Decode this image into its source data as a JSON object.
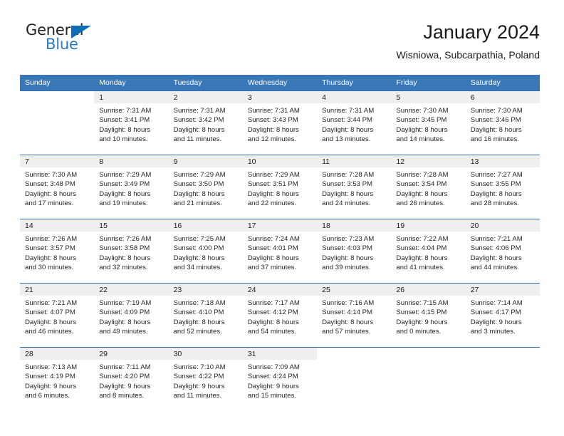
{
  "brand": {
    "name_part1": "General",
    "name_part2": "Blue",
    "logo_icon": "triangle-logo-icon"
  },
  "header": {
    "title": "January 2024",
    "subtitle": "Wisniowa, Subcarpathia, Poland"
  },
  "colors": {
    "header_blue": "#3977b7",
    "row_border_blue": "#2f6fae",
    "daynum_band": "#efefef",
    "brand_blue": "#2b7cc4",
    "logo_blue": "#126cb5"
  },
  "calendar": {
    "weekday_headers": [
      "Sunday",
      "Monday",
      "Tuesday",
      "Wednesday",
      "Thursday",
      "Friday",
      "Saturday"
    ],
    "labels": {
      "sunrise": "Sunrise:",
      "sunset": "Sunset:",
      "daylight": "Daylight:"
    },
    "weeks": [
      [
        {
          "day": "",
          "blank": true,
          "sunrise": "",
          "sunset": "",
          "daylight_line1": "",
          "daylight_line2": ""
        },
        {
          "day": "1",
          "blank": false,
          "sunrise": "Sunrise: 7:31 AM",
          "sunset": "Sunset: 3:41 PM",
          "daylight_line1": "Daylight: 8 hours",
          "daylight_line2": "and 10 minutes."
        },
        {
          "day": "2",
          "blank": false,
          "sunrise": "Sunrise: 7:31 AM",
          "sunset": "Sunset: 3:42 PM",
          "daylight_line1": "Daylight: 8 hours",
          "daylight_line2": "and 11 minutes."
        },
        {
          "day": "3",
          "blank": false,
          "sunrise": "Sunrise: 7:31 AM",
          "sunset": "Sunset: 3:43 PM",
          "daylight_line1": "Daylight: 8 hours",
          "daylight_line2": "and 12 minutes."
        },
        {
          "day": "4",
          "blank": false,
          "sunrise": "Sunrise: 7:31 AM",
          "sunset": "Sunset: 3:44 PM",
          "daylight_line1": "Daylight: 8 hours",
          "daylight_line2": "and 13 minutes."
        },
        {
          "day": "5",
          "blank": false,
          "sunrise": "Sunrise: 7:30 AM",
          "sunset": "Sunset: 3:45 PM",
          "daylight_line1": "Daylight: 8 hours",
          "daylight_line2": "and 14 minutes."
        },
        {
          "day": "6",
          "blank": false,
          "sunrise": "Sunrise: 7:30 AM",
          "sunset": "Sunset: 3:46 PM",
          "daylight_line1": "Daylight: 8 hours",
          "daylight_line2": "and 16 minutes."
        }
      ],
      [
        {
          "day": "7",
          "blank": false,
          "sunrise": "Sunrise: 7:30 AM",
          "sunset": "Sunset: 3:48 PM",
          "daylight_line1": "Daylight: 8 hours",
          "daylight_line2": "and 17 minutes."
        },
        {
          "day": "8",
          "blank": false,
          "sunrise": "Sunrise: 7:29 AM",
          "sunset": "Sunset: 3:49 PM",
          "daylight_line1": "Daylight: 8 hours",
          "daylight_line2": "and 19 minutes."
        },
        {
          "day": "9",
          "blank": false,
          "sunrise": "Sunrise: 7:29 AM",
          "sunset": "Sunset: 3:50 PM",
          "daylight_line1": "Daylight: 8 hours",
          "daylight_line2": "and 21 minutes."
        },
        {
          "day": "10",
          "blank": false,
          "sunrise": "Sunrise: 7:29 AM",
          "sunset": "Sunset: 3:51 PM",
          "daylight_line1": "Daylight: 8 hours",
          "daylight_line2": "and 22 minutes."
        },
        {
          "day": "11",
          "blank": false,
          "sunrise": "Sunrise: 7:28 AM",
          "sunset": "Sunset: 3:53 PM",
          "daylight_line1": "Daylight: 8 hours",
          "daylight_line2": "and 24 minutes."
        },
        {
          "day": "12",
          "blank": false,
          "sunrise": "Sunrise: 7:28 AM",
          "sunset": "Sunset: 3:54 PM",
          "daylight_line1": "Daylight: 8 hours",
          "daylight_line2": "and 26 minutes."
        },
        {
          "day": "13",
          "blank": false,
          "sunrise": "Sunrise: 7:27 AM",
          "sunset": "Sunset: 3:55 PM",
          "daylight_line1": "Daylight: 8 hours",
          "daylight_line2": "and 28 minutes."
        }
      ],
      [
        {
          "day": "14",
          "blank": false,
          "sunrise": "Sunrise: 7:26 AM",
          "sunset": "Sunset: 3:57 PM",
          "daylight_line1": "Daylight: 8 hours",
          "daylight_line2": "and 30 minutes."
        },
        {
          "day": "15",
          "blank": false,
          "sunrise": "Sunrise: 7:26 AM",
          "sunset": "Sunset: 3:58 PM",
          "daylight_line1": "Daylight: 8 hours",
          "daylight_line2": "and 32 minutes."
        },
        {
          "day": "16",
          "blank": false,
          "sunrise": "Sunrise: 7:25 AM",
          "sunset": "Sunset: 4:00 PM",
          "daylight_line1": "Daylight: 8 hours",
          "daylight_line2": "and 34 minutes."
        },
        {
          "day": "17",
          "blank": false,
          "sunrise": "Sunrise: 7:24 AM",
          "sunset": "Sunset: 4:01 PM",
          "daylight_line1": "Daylight: 8 hours",
          "daylight_line2": "and 37 minutes."
        },
        {
          "day": "18",
          "blank": false,
          "sunrise": "Sunrise: 7:23 AM",
          "sunset": "Sunset: 4:03 PM",
          "daylight_line1": "Daylight: 8 hours",
          "daylight_line2": "and 39 minutes."
        },
        {
          "day": "19",
          "blank": false,
          "sunrise": "Sunrise: 7:22 AM",
          "sunset": "Sunset: 4:04 PM",
          "daylight_line1": "Daylight: 8 hours",
          "daylight_line2": "and 41 minutes."
        },
        {
          "day": "20",
          "blank": false,
          "sunrise": "Sunrise: 7:21 AM",
          "sunset": "Sunset: 4:06 PM",
          "daylight_line1": "Daylight: 8 hours",
          "daylight_line2": "and 44 minutes."
        }
      ],
      [
        {
          "day": "21",
          "blank": false,
          "sunrise": "Sunrise: 7:21 AM",
          "sunset": "Sunset: 4:07 PM",
          "daylight_line1": "Daylight: 8 hours",
          "daylight_line2": "and 46 minutes."
        },
        {
          "day": "22",
          "blank": false,
          "sunrise": "Sunrise: 7:19 AM",
          "sunset": "Sunset: 4:09 PM",
          "daylight_line1": "Daylight: 8 hours",
          "daylight_line2": "and 49 minutes."
        },
        {
          "day": "23",
          "blank": false,
          "sunrise": "Sunrise: 7:18 AM",
          "sunset": "Sunset: 4:10 PM",
          "daylight_line1": "Daylight: 8 hours",
          "daylight_line2": "and 52 minutes."
        },
        {
          "day": "24",
          "blank": false,
          "sunrise": "Sunrise: 7:17 AM",
          "sunset": "Sunset: 4:12 PM",
          "daylight_line1": "Daylight: 8 hours",
          "daylight_line2": "and 54 minutes."
        },
        {
          "day": "25",
          "blank": false,
          "sunrise": "Sunrise: 7:16 AM",
          "sunset": "Sunset: 4:14 PM",
          "daylight_line1": "Daylight: 8 hours",
          "daylight_line2": "and 57 minutes."
        },
        {
          "day": "26",
          "blank": false,
          "sunrise": "Sunrise: 7:15 AM",
          "sunset": "Sunset: 4:15 PM",
          "daylight_line1": "Daylight: 9 hours",
          "daylight_line2": "and 0 minutes."
        },
        {
          "day": "27",
          "blank": false,
          "sunrise": "Sunrise: 7:14 AM",
          "sunset": "Sunset: 4:17 PM",
          "daylight_line1": "Daylight: 9 hours",
          "daylight_line2": "and 3 minutes."
        }
      ],
      [
        {
          "day": "28",
          "blank": false,
          "sunrise": "Sunrise: 7:13 AM",
          "sunset": "Sunset: 4:19 PM",
          "daylight_line1": "Daylight: 9 hours",
          "daylight_line2": "and 6 minutes."
        },
        {
          "day": "29",
          "blank": false,
          "sunrise": "Sunrise: 7:11 AM",
          "sunset": "Sunset: 4:20 PM",
          "daylight_line1": "Daylight: 9 hours",
          "daylight_line2": "and 8 minutes."
        },
        {
          "day": "30",
          "blank": false,
          "sunrise": "Sunrise: 7:10 AM",
          "sunset": "Sunset: 4:22 PM",
          "daylight_line1": "Daylight: 9 hours",
          "daylight_line2": "and 11 minutes."
        },
        {
          "day": "31",
          "blank": false,
          "sunrise": "Sunrise: 7:09 AM",
          "sunset": "Sunset: 4:24 PM",
          "daylight_line1": "Daylight: 9 hours",
          "daylight_line2": "and 15 minutes."
        },
        {
          "day": "",
          "blank": true,
          "sunrise": "",
          "sunset": "",
          "daylight_line1": "",
          "daylight_line2": ""
        },
        {
          "day": "",
          "blank": true,
          "sunrise": "",
          "sunset": "",
          "daylight_line1": "",
          "daylight_line2": ""
        },
        {
          "day": "",
          "blank": true,
          "sunrise": "",
          "sunset": "",
          "daylight_line1": "",
          "daylight_line2": ""
        }
      ]
    ]
  }
}
